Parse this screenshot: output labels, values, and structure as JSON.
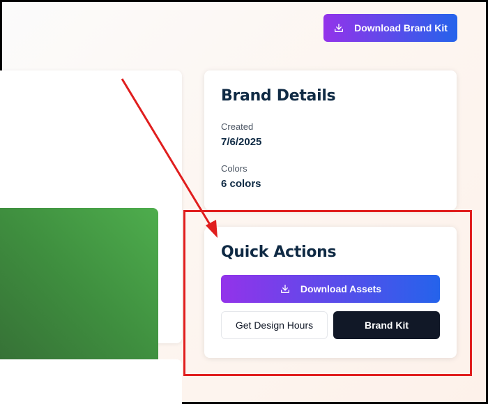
{
  "header": {
    "download_brand_kit_label": "Download Brand Kit",
    "download_icon": "download-icon"
  },
  "details": {
    "title": "Brand Details",
    "created_label": "Created",
    "created_value": "7/6/2025",
    "colors_label": "Colors",
    "colors_value": "6 colors"
  },
  "quick_actions": {
    "title": "Quick Actions",
    "download_assets_label": "Download Assets",
    "get_design_hours_label": "Get Design Hours",
    "brand_kit_label": "Brand Kit"
  },
  "swatch": {
    "color": "#4ead4d"
  },
  "annotation": {
    "color": "#e01e1e"
  },
  "theme": {
    "accent_start": "#9333ea",
    "accent_end": "#2563eb",
    "heading_color": "#0f2a44",
    "dark_button": "#111827"
  }
}
